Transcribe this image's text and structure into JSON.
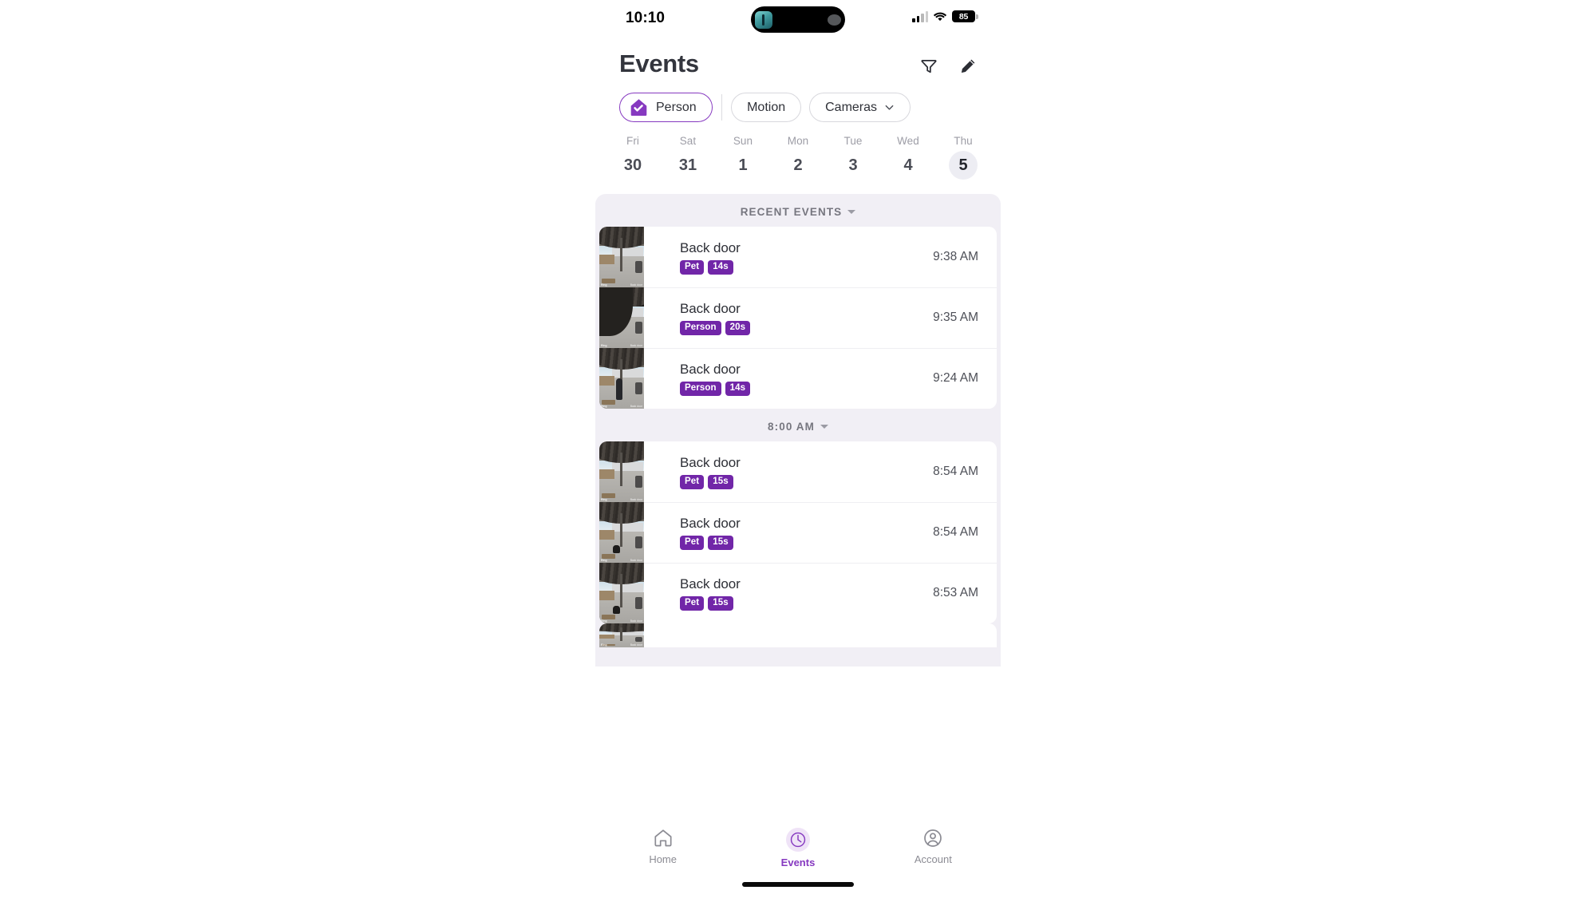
{
  "status_bar": {
    "time": "10:10",
    "battery_level": "85",
    "signal_icon": "cellular-signal-icon",
    "wifi_icon": "wifi-icon",
    "battery_icon": "battery-icon"
  },
  "header": {
    "title": "Events",
    "filter_icon": "filter-funnel-icon",
    "edit_icon": "pencil-edit-icon"
  },
  "filters": {
    "chips": [
      {
        "label": "Person",
        "active": true,
        "icon": "house-check-icon"
      },
      {
        "label": "Motion",
        "active": false,
        "icon": ""
      },
      {
        "label": "Cameras",
        "active": false,
        "icon": "chevron-down-icon"
      }
    ]
  },
  "week_strip": {
    "days": [
      {
        "dow": "Fri",
        "num": "30",
        "selected": false
      },
      {
        "dow": "Sat",
        "num": "31",
        "selected": false
      },
      {
        "dow": "Sun",
        "num": "1",
        "selected": false
      },
      {
        "dow": "Mon",
        "num": "2",
        "selected": false
      },
      {
        "dow": "Tue",
        "num": "3",
        "selected": false
      },
      {
        "dow": "Wed",
        "num": "4",
        "selected": false
      },
      {
        "dow": "Thu",
        "num": "5",
        "selected": true
      }
    ]
  },
  "event_groups": [
    {
      "heading": "RECENT EVENTS",
      "events": [
        {
          "camera": "Back door",
          "type": "Pet",
          "duration": "14s",
          "time": "9:38 AM",
          "thumb": "patio-wide"
        },
        {
          "camera": "Back door",
          "type": "Person",
          "duration": "20s",
          "time": "9:35 AM",
          "thumb": "patio-closeup"
        },
        {
          "camera": "Back door",
          "type": "Person",
          "duration": "14s",
          "time": "9:24 AM",
          "thumb": "patio-person"
        }
      ]
    },
    {
      "heading": "8:00 AM",
      "events": [
        {
          "camera": "Back door",
          "type": "Pet",
          "duration": "15s",
          "time": "8:54 AM",
          "thumb": "patio-wide"
        },
        {
          "camera": "Back door",
          "type": "Pet",
          "duration": "15s",
          "time": "8:54 AM",
          "thumb": "patio-pet"
        },
        {
          "camera": "Back door",
          "type": "Pet",
          "duration": "15s",
          "time": "8:53 AM",
          "thumb": "patio-pet"
        }
      ]
    }
  ],
  "tab_bar": {
    "tabs": [
      {
        "label": "Home",
        "icon": "home-icon",
        "active": false
      },
      {
        "label": "Events",
        "icon": "clock-icon",
        "active": true
      },
      {
        "label": "Account",
        "icon": "person-circle-icon",
        "active": false
      }
    ]
  },
  "colors": {
    "accent_purple": "#8639c0",
    "badge_purple": "#7126a8",
    "page_bg": "#f1eff5",
    "text_dark": "#2d2f36",
    "text_muted": "#9d9da6"
  }
}
